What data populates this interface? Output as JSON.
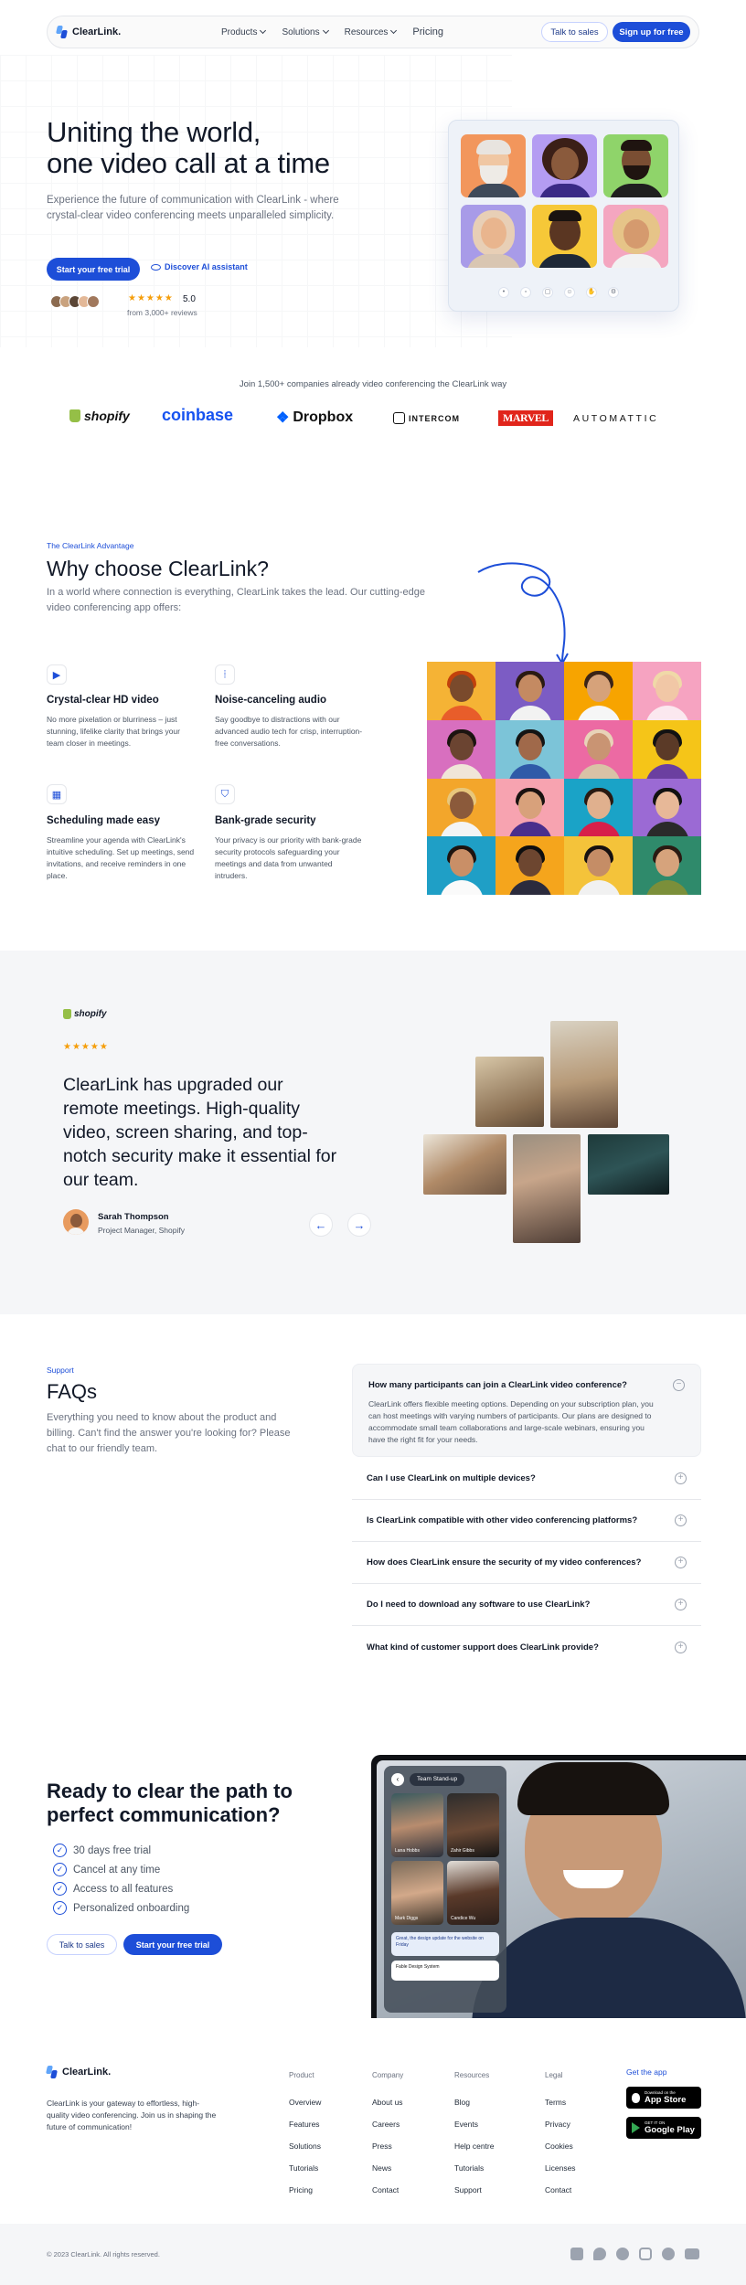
{
  "colors": {
    "brand": "#1d4ed8",
    "star": "#f59e0b",
    "text": "#111827",
    "muted": "#6b7280"
  },
  "nav": {
    "logo": "ClearLink.",
    "links": [
      {
        "label": "Products",
        "dropdown": true
      },
      {
        "label": "Solutions",
        "dropdown": true
      },
      {
        "label": "Resources",
        "dropdown": true
      },
      {
        "label": "Pricing",
        "dropdown": false
      }
    ],
    "talk_to_sales": "Talk to sales",
    "sign_up": "Sign up for free"
  },
  "hero": {
    "title_line1": "Uniting the world,",
    "title_line2": "one video call at a time",
    "subtitle": "Experience the future of communication with ClearLink - where crystal-clear video conferencing meets unparalleled simplicity.",
    "cta_primary": "Start your free trial",
    "cta_secondary": "Discover AI assistant",
    "rating_stars": "★★★★★",
    "rating_value": "5.0",
    "reviews": "from 3,000+ reviews"
  },
  "logos": {
    "caption": "Join 1,500+ companies already video conferencing the ClearLink way",
    "brands": [
      "shopify",
      "coinbase",
      "Dropbox",
      "INTERCOM",
      "MARVEL",
      "AUTOMATTIC"
    ]
  },
  "why": {
    "eyebrow": "The ClearLink Advantage",
    "title": "Why choose ClearLink?",
    "subtitle": "In a world where connection is everything, ClearLink takes the lead. Our cutting-edge video conferencing app offers:",
    "features": [
      {
        "icon": "video-icon",
        "title": "Crystal-clear HD video",
        "desc": "No more pixelation or blurriness – just stunning, lifelike clarity that brings your team closer in meetings."
      },
      {
        "icon": "audio-wave-icon",
        "title": "Noise-canceling audio",
        "desc": "Say goodbye to distractions with our advanced audio tech for crisp, interruption-free conversations."
      },
      {
        "icon": "calendar-icon",
        "title": "Scheduling made easy",
        "desc": "Streamline your agenda with ClearLink's intuitive scheduling. Set up meetings, send invitations, and receive reminders in one place."
      },
      {
        "icon": "shield-icon",
        "title": "Bank-grade security",
        "desc": "Your privacy is our priority with bank-grade security protocols safeguarding your meetings and data from unwanted intruders."
      }
    ]
  },
  "testimonial": {
    "brand": "shopify",
    "stars": "★★★★★",
    "quote": "ClearLink has upgraded our remote meetings. High-quality video, screen sharing, and top-notch security make it essential for our team.",
    "author": "Sarah Thompson",
    "role": "Project Manager, Shopify",
    "prev": "←",
    "next": "→"
  },
  "faq": {
    "eyebrow": "Support",
    "title": "FAQs",
    "subtitle": "Everything you need to know about the product and billing. Can't find the answer you're looking for? Please chat to our friendly team.",
    "open": {
      "q": "How many participants can join a ClearLink video conference?",
      "a": "ClearLink offers flexible meeting options. Depending on your subscription plan, you can host meetings with varying numbers of participants. Our plans are designed to accommodate small team collaborations and large-scale webinars, ensuring you have the right fit for your needs."
    },
    "items": [
      "Can I use ClearLink on multiple devices?",
      "Is ClearLink compatible with other video conferencing platforms?",
      "How does ClearLink ensure the security of my video conferences?",
      "Do I need to download any software to use ClearLink?",
      "What kind of customer support does ClearLink provide?"
    ]
  },
  "cta": {
    "title_line1": "Ready to clear the path to",
    "title_line2": "perfect communication?",
    "checks": [
      "30 days free trial",
      "Cancel at any time",
      "Access to all features",
      "Personalized onboarding"
    ],
    "talk_to_sales": "Talk to sales",
    "start_trial": "Start your free trial",
    "app_window": {
      "meeting_name": "Team Stand-up",
      "participants": [
        "Lana Hobbs",
        "Zahir Gibbs",
        "Mark Diggs",
        "Candice Wu"
      ],
      "chat_1": "Great, the design update for the website on Friday",
      "chat_2": "Fable Design System"
    }
  },
  "footer": {
    "logo": "ClearLink.",
    "tagline": "ClearLink is your gateway to effortless, high-quality video conferencing. Join us in shaping the future of communication!",
    "columns": [
      {
        "title": "Product",
        "links": [
          "Overview",
          "Features",
          "Solutions",
          "Tutorials",
          "Pricing"
        ]
      },
      {
        "title": "Company",
        "links": [
          "About us",
          "Careers",
          "Press",
          "News",
          "Contact"
        ]
      },
      {
        "title": "Resources",
        "links": [
          "Blog",
          "Events",
          "Help centre",
          "Tutorials",
          "Support"
        ]
      },
      {
        "title": "Legal",
        "links": [
          "Terms",
          "Privacy",
          "Cookies",
          "Licenses",
          "Contact"
        ]
      }
    ],
    "get_app": "Get the app",
    "app_store_small": "Download on the",
    "app_store": "App Store",
    "google_play_small": "GET IT ON",
    "google_play": "Google Play",
    "copyright": "© 2023 ClearLink. All rights reserved.",
    "socials": [
      "linkedin-icon",
      "twitter-icon",
      "facebook-icon",
      "instagram-icon",
      "github-icon",
      "youtube-icon"
    ]
  }
}
